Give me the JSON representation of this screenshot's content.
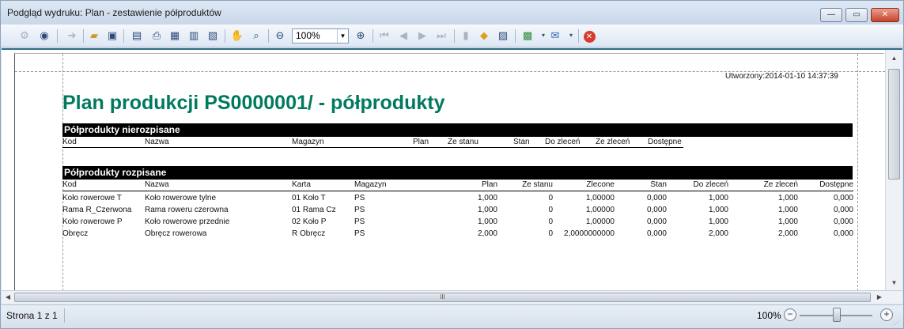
{
  "window": {
    "title": "Podgląd wydruku: Plan - zestawienie półproduktów",
    "buttons": {
      "minimize": "—",
      "maximize": "▭",
      "close": "✕"
    }
  },
  "toolbar": {
    "icons": [
      "print-setup-icon",
      "binoculars-icon",
      "export-icon",
      "open-folder-icon",
      "save-disk-icon",
      "page-setup-icon",
      "print-icon",
      "quick-print-icon",
      "header-footer-icon",
      "scale-icon",
      "hand-tool-icon",
      "magnifier-icon",
      "zoom-out-icon",
      "zoom-in-icon",
      "first-page-icon",
      "prev-page-icon",
      "next-page-icon",
      "last-page-icon",
      "multiple-pages-icon",
      "color-icon",
      "watermark-icon",
      "export-document-icon",
      "send-email-icon",
      "close-preview-icon"
    ],
    "zoom_value": "100%"
  },
  "report": {
    "created": "Utworzony:2014-01-10 14:37:39",
    "title": "Plan produkcji PS0000001/ - półprodukty",
    "section1": {
      "heading": "Półprodukty nierozpisane",
      "columns": [
        "Kod",
        "Nazwa",
        "Magazyn",
        "Plan",
        "Ze stanu",
        "Stan",
        "Do zleceń",
        "Ze zleceń",
        "Dostępne"
      ]
    },
    "section2": {
      "heading": "Półprodukty rozpisane",
      "columns": [
        "Kod",
        "Nazwa",
        "Karta",
        "Magazyn",
        "Plan",
        "Ze stanu",
        "Zlecone",
        "Stan",
        "Do zleceń",
        "Ze zleceń",
        "Dostępne"
      ],
      "rows": [
        [
          "Koło rowerowe T",
          "Koło rowerowe tylne",
          "01 Koło  T",
          "PS",
          "1,000",
          "0",
          "1,00000",
          "0,000",
          "1,000",
          "1,000",
          "0,000"
        ],
        [
          "Rama R_Czerwona",
          "Rama roweru czerowna",
          "01 Rama Cz",
          "PS",
          "1,000",
          "0",
          "1,00000",
          "0,000",
          "1,000",
          "1,000",
          "0,000"
        ],
        [
          "Koło rowerowe P",
          "Koło rowerowe przednie",
          "02 Koło  P",
          "PS",
          "1,000",
          "0",
          "1,00000",
          "0,000",
          "1,000",
          "1,000",
          "0,000"
        ],
        [
          "Obręcz",
          "Obręcz rowerowa",
          "R Obręcz",
          "PS",
          "2,000",
          "0",
          "2,0000000000",
          "0,000",
          "2,000",
          "2,000",
          "0,000"
        ]
      ]
    }
  },
  "scrollbar": {
    "grip": "III"
  },
  "status": {
    "page": "Strona 1 z 1",
    "zoom": "100%",
    "zoom_out": "−",
    "zoom_in": "+"
  },
  "colors": {
    "title_green": "#007a5e",
    "band_black": "#000000",
    "window_frame": "#dbe5f1"
  }
}
